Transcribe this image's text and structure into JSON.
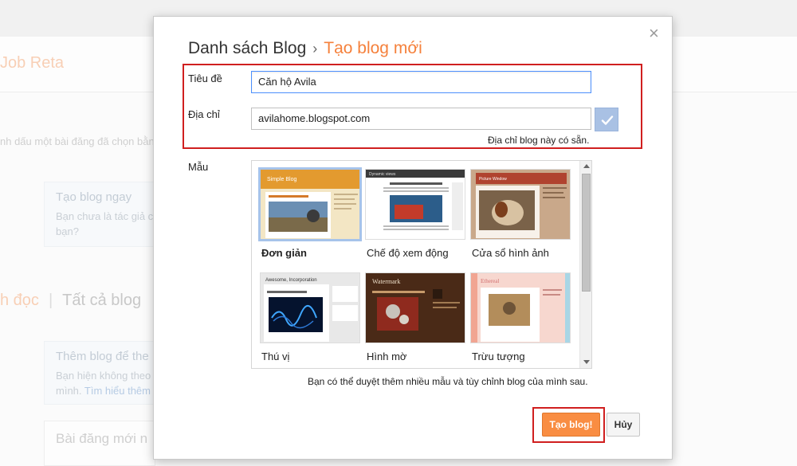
{
  "background": {
    "blog_name": "Job Reta",
    "hint_text": "nh dấu một bài đăng đã chọn bằn",
    "card1": {
      "title": "Tạo blog ngay",
      "line1": "Bạn chưa là tác giả c",
      "line2": "bạn?"
    },
    "tabs": {
      "reading": "h đọc",
      "separator": "|",
      "all_blogs": "Tất cả blog"
    },
    "card2": {
      "title": "Thêm blog để the",
      "line1": "Bạn hiện không theo",
      "line2_text": "mình.",
      "line2_link": "Tìm hiểu thêm"
    },
    "posts_title": "Bài đăng mới n"
  },
  "dialog": {
    "close_glyph": "×",
    "breadcrumb": {
      "root": "Danh sách Blog",
      "separator": "›",
      "current": "Tạo blog mới"
    },
    "title_field": {
      "label": "Tiêu đề",
      "value": "Căn hộ Avila"
    },
    "address_field": {
      "label": "Địa chỉ",
      "value": "avilahome.blogspot.com",
      "status": "Địa chỉ blog này có sẵn."
    },
    "templates": {
      "label": "Mẫu",
      "items": [
        {
          "name": "Đơn giản",
          "header_text": "Simple Blog",
          "selected": true
        },
        {
          "name": "Chế độ xem động",
          "header_text": "Dynamic views",
          "selected": false
        },
        {
          "name": "Cửa sổ hình ảnh",
          "header_text": "Picture Window",
          "selected": false
        },
        {
          "name": "Thú vị",
          "header_text": "Awesome, Incorporation",
          "selected": false
        },
        {
          "name": "Hình mờ",
          "header_text": "Watermark",
          "selected": false
        },
        {
          "name": "Trừu tượng",
          "header_text": "Ethereal",
          "selected": false
        }
      ]
    },
    "browse_note": "Bạn có thể duyệt thêm nhiều mẫu và tùy chỉnh blog của mình sau.",
    "buttons": {
      "create": "Tạo blog!",
      "cancel": "Hủy"
    }
  },
  "colors": {
    "accent": "#f5813c",
    "create_button": "#f98d42",
    "focus_border": "#4d90fe",
    "highlight_box": "#d01f1f"
  }
}
